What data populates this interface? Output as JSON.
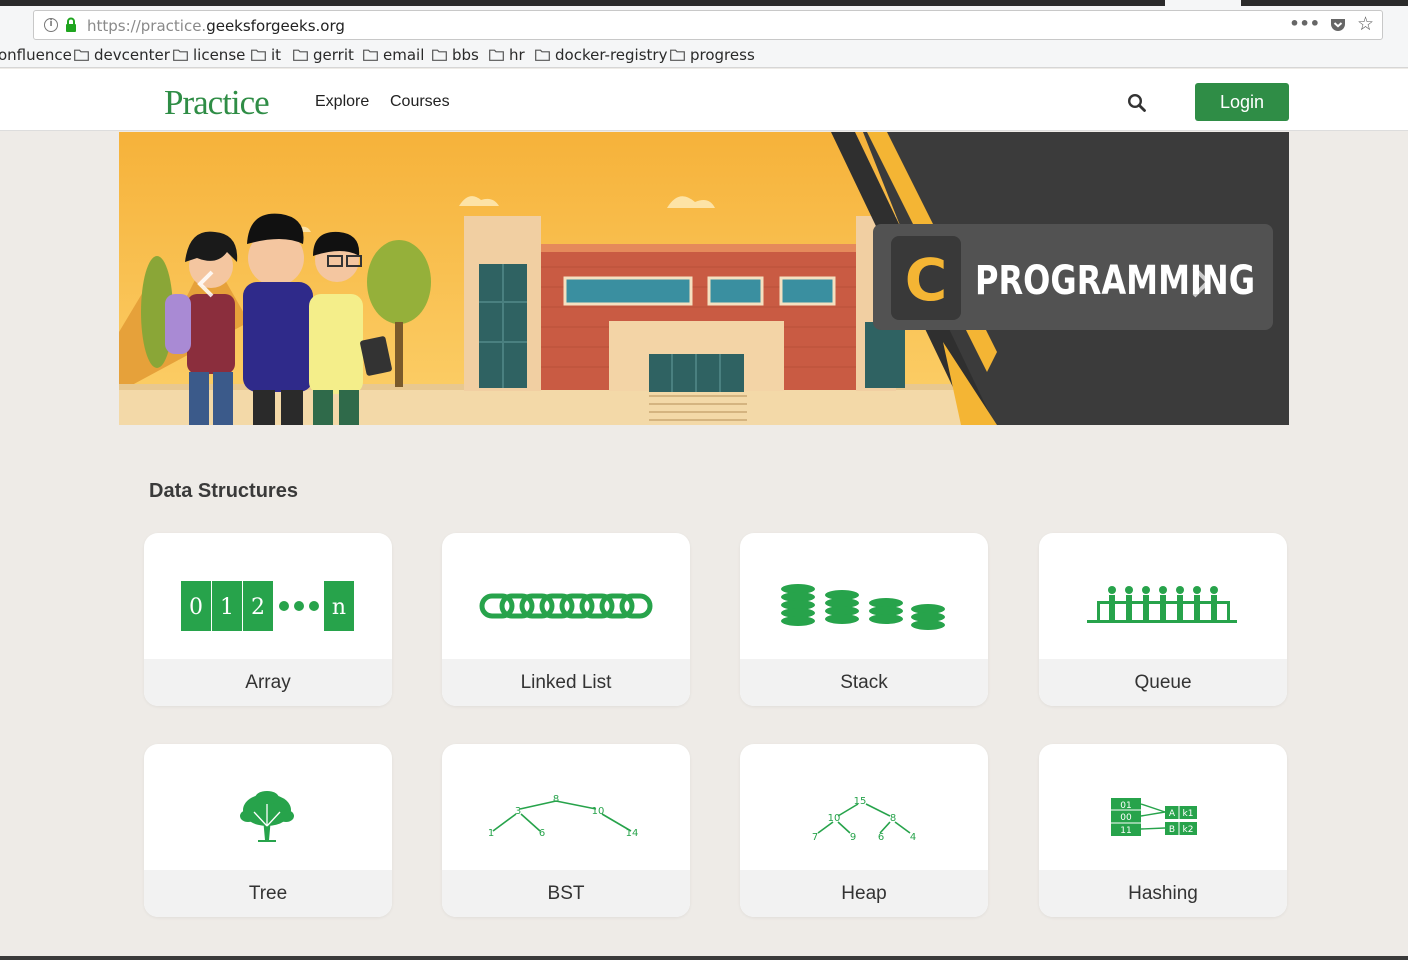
{
  "browser": {
    "url_protocol": "https://practice.",
    "url_domain": "geeksforgeeks.org",
    "more_label": "•••",
    "bookmarks": [
      "onfluence",
      "devcenter",
      "license",
      "it",
      "gerrit",
      "email",
      "bbs",
      "hr",
      "docker-registry",
      "progress"
    ]
  },
  "header": {
    "logo": "Practice",
    "nav": [
      "Explore",
      "Courses"
    ],
    "login_label": "Login"
  },
  "banner": {
    "badge_letter": "C",
    "badge_text": "PROGRAMMING",
    "array_glyphs": [
      "0",
      "1",
      "2",
      "n"
    ]
  },
  "section": {
    "title": "Data Structures",
    "cards": [
      {
        "label": "Array",
        "icon": "array-icon"
      },
      {
        "label": "Linked List",
        "icon": "linked-list-icon"
      },
      {
        "label": "Stack",
        "icon": "stack-icon"
      },
      {
        "label": "Queue",
        "icon": "queue-icon"
      },
      {
        "label": "Tree",
        "icon": "tree-icon"
      },
      {
        "label": "BST",
        "icon": "bst-icon"
      },
      {
        "label": "Heap",
        "icon": "heap-icon"
      },
      {
        "label": "Hashing",
        "icon": "hashing-icon"
      }
    ],
    "bst_nodes": [
      "8",
      "3",
      "10",
      "1",
      "6",
      "14"
    ],
    "heap_nodes": [
      "15",
      "10",
      "8",
      "7",
      "9",
      "6",
      "4"
    ],
    "hash_keys": [
      "01",
      "00",
      "11"
    ],
    "hash_values": [
      "A",
      "k1",
      "B",
      "k2"
    ]
  },
  "colors": {
    "brand_green": "#2f8d46",
    "icon_green": "#27a34b",
    "page_bg": "#eeebe7"
  }
}
